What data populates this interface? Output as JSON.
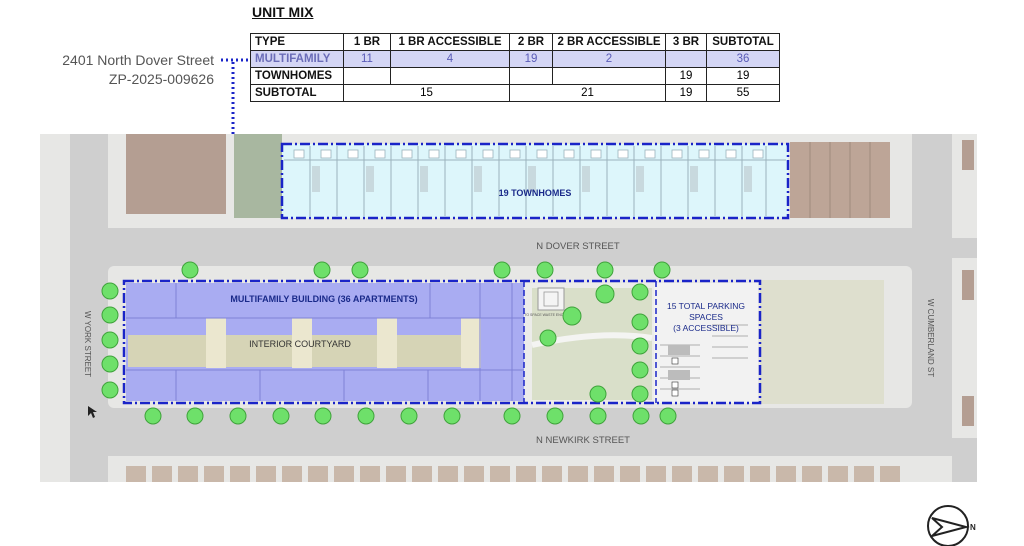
{
  "unit_mix": {
    "title": "UNIT MIX",
    "headers": [
      "TYPE",
      "1 BR",
      "1 BR ACCESSIBLE",
      "2 BR",
      "2 BR ACCESSIBLE",
      "3 BR",
      "SUBTOTAL"
    ],
    "rows": {
      "multifamily": [
        "MULTIFAMILY",
        "11",
        "4",
        "19",
        "2",
        "",
        "36"
      ],
      "townhomes": [
        "TOWNHOMES",
        "",
        "",
        "",
        "",
        "19",
        "19"
      ],
      "subtotal": [
        "SUBTOTAL",
        "15",
        "21",
        "19",
        "55"
      ]
    }
  },
  "address": {
    "line1": "2401 North Dover Street",
    "line2": "ZP-2025-009626"
  },
  "map": {
    "townhomes_label": "19 TOWNHOMES",
    "multifamily_label": "MULTIFAMILY BUILDING (36 APARTMENTS)",
    "courtyard_label": "INTERIOR COURTYARD",
    "parking_label_1": "15 TOTAL PARKING",
    "parking_label_2": "SPACES",
    "parking_label_3": "(3 ACCESSIBLE)",
    "dover_street": "N DOVER STREET",
    "newkirk_street": "N NEWKIRK STREET",
    "york_street": "W YORK STREET",
    "cumberland_street": "W CUMBERLAND ST",
    "trash_label": "TO SPACE WASTE ENCLOSURE",
    "north_label": "N"
  },
  "colors": {
    "building_blue": "#a9acf2",
    "townhome_cyan": "#ddf6fb",
    "outline_blue": "#1a24c8",
    "tree_green": "#6ee06a",
    "road_gray": "#cfcfcf",
    "sidewalk_gray": "#e7e7e5",
    "open_space_green": "#d9dfc9"
  }
}
